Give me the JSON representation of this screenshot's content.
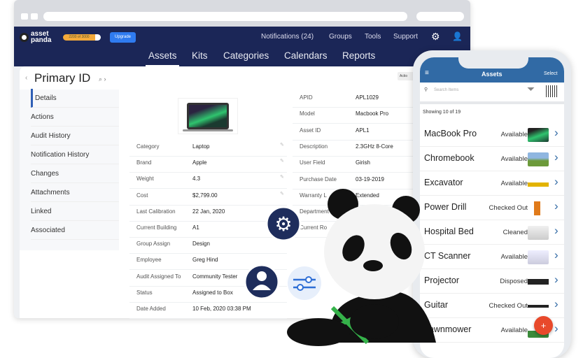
{
  "header": {
    "logo": "asset panda",
    "usage_badge": "2200 of 3000",
    "upgrade_label": "Upgrade",
    "top_links": [
      "Notifications (24)",
      "Groups",
      "Tools",
      "Support"
    ],
    "main_tabs": [
      "Assets",
      "Kits",
      "Categories",
      "Calendars",
      "Reports"
    ]
  },
  "page": {
    "title": "Primary ID",
    "actions_label": "Actio"
  },
  "sidebar": [
    "Details",
    "Actions",
    "Audit History",
    "Notification History",
    "Changes",
    "Attachments",
    "Linked",
    "Associated"
  ],
  "left_fields": [
    [
      "Category",
      "Laptop"
    ],
    [
      "Brand",
      "Apple"
    ],
    [
      "Weight",
      "4.3"
    ],
    [
      "Cost",
      "$2,799.00"
    ],
    [
      "Last Calibration",
      "22 Jan, 2020"
    ],
    [
      "Current Building",
      "A1"
    ],
    [
      "Group Assign",
      "Design"
    ],
    [
      "Employee",
      "Greg Hind"
    ],
    [
      "Audit Assigned To",
      "Community Tester"
    ],
    [
      "Status",
      "Assigned to Box"
    ],
    [
      "Date Added",
      "10 Feb, 2020 03:38 PM"
    ]
  ],
  "right_fields": [
    [
      "APID",
      "APL1029"
    ],
    [
      "Model",
      "Macbook Pro"
    ],
    [
      "Asset ID",
      "APL1"
    ],
    [
      "Description",
      "2.3GHz 8-Core"
    ],
    [
      "User Field",
      "Girish"
    ],
    [
      "Purchase Date",
      "03-19-2019"
    ],
    [
      "Warranty L",
      "Extended"
    ],
    [
      "Department",
      ""
    ],
    [
      "Current Ro",
      ""
    ]
  ],
  "mobile": {
    "title": "Assets",
    "select": "Select",
    "search_placeholder": "Search Items",
    "showing": "Showing 10 of 19",
    "items": [
      [
        "MacBook Pro",
        "Available"
      ],
      [
        "Chromebook",
        "Available"
      ],
      [
        "Excavator",
        "Available"
      ],
      [
        "Power Drill",
        "Checked Out"
      ],
      [
        "Hospital Bed",
        "Cleaned"
      ],
      [
        "CT Scanner",
        "Available"
      ],
      [
        "Projector",
        "Disposed"
      ],
      [
        "Guitar",
        "Checked Out"
      ],
      [
        "Lawnmower",
        "Available"
      ]
    ],
    "fab": "+"
  },
  "colors": {
    "nav": "#1b2657",
    "mobile_header": "#316aa5",
    "fab": "#e8492b"
  }
}
